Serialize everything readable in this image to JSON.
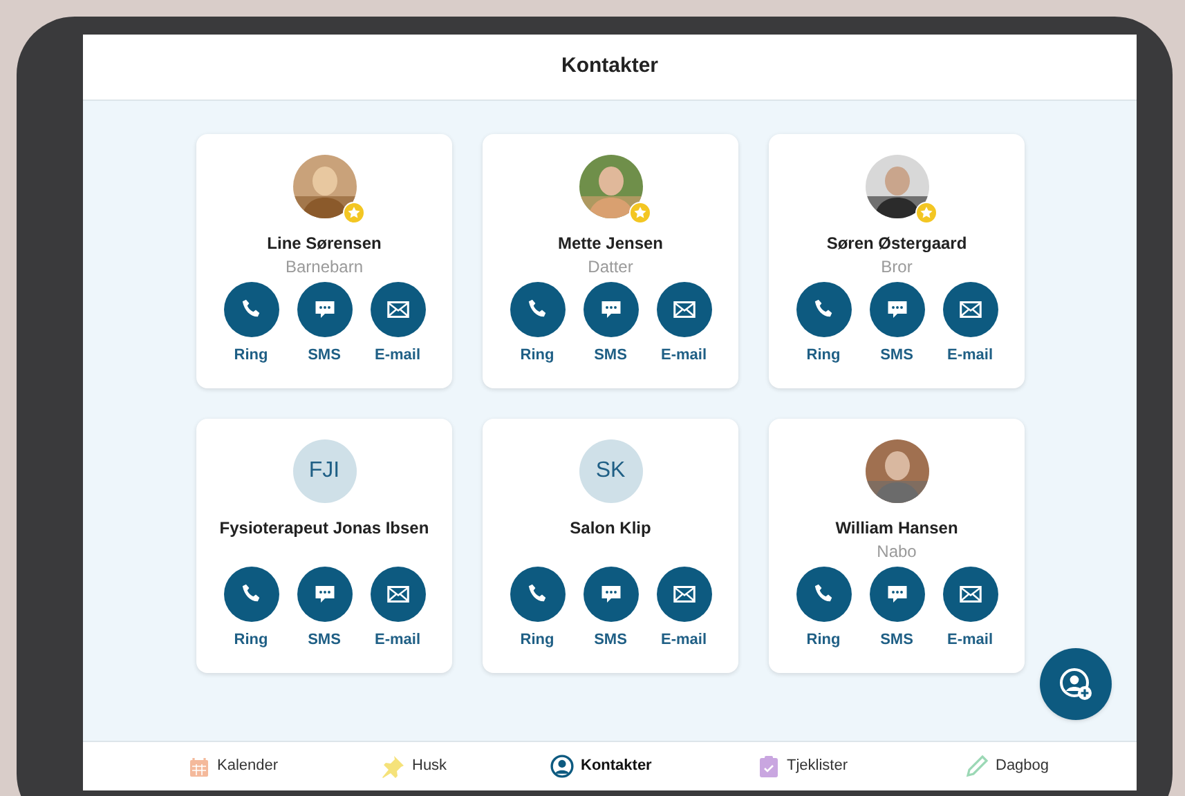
{
  "header": {
    "title": "Kontakter"
  },
  "contacts": [
    {
      "name": "Line Sørensen",
      "relation": "Barnebarn",
      "favorite": true,
      "actions": [
        "Ring",
        "SMS",
        "E-mail"
      ]
    },
    {
      "name": "Mette Jensen",
      "relation": "Datter",
      "favorite": true,
      "actions": [
        "Ring",
        "SMS",
        "E-mail"
      ]
    },
    {
      "name": "Søren Østergaard",
      "relation": "Bror",
      "favorite": true,
      "actions": [
        "Ring",
        "SMS",
        "E-mail"
      ]
    },
    {
      "name": "Fysioterapeut Jonas Ibsen",
      "avatar": {
        "kind": "initials",
        "text": "FJI"
      },
      "favorite": false,
      "actions": [
        "Ring",
        "SMS",
        "E-mail"
      ]
    },
    {
      "name": "Salon Klip",
      "avatar": {
        "kind": "initials",
        "text": "SK"
      },
      "favorite": false,
      "actions": [
        "Ring",
        "SMS",
        "E-mail"
      ]
    },
    {
      "name": "William Hansen",
      "relation": "Nabo",
      "favorite": false,
      "actions": [
        "Ring",
        "SMS",
        "E-mail"
      ]
    }
  ],
  "nav": [
    {
      "label": "Kalender",
      "selected": false
    },
    {
      "label": "Husk",
      "selected": false
    },
    {
      "label": "Kontakter",
      "selected": true
    },
    {
      "label": "Tjeklister",
      "selected": false
    },
    {
      "label": "Dagbog",
      "selected": false
    }
  ]
}
